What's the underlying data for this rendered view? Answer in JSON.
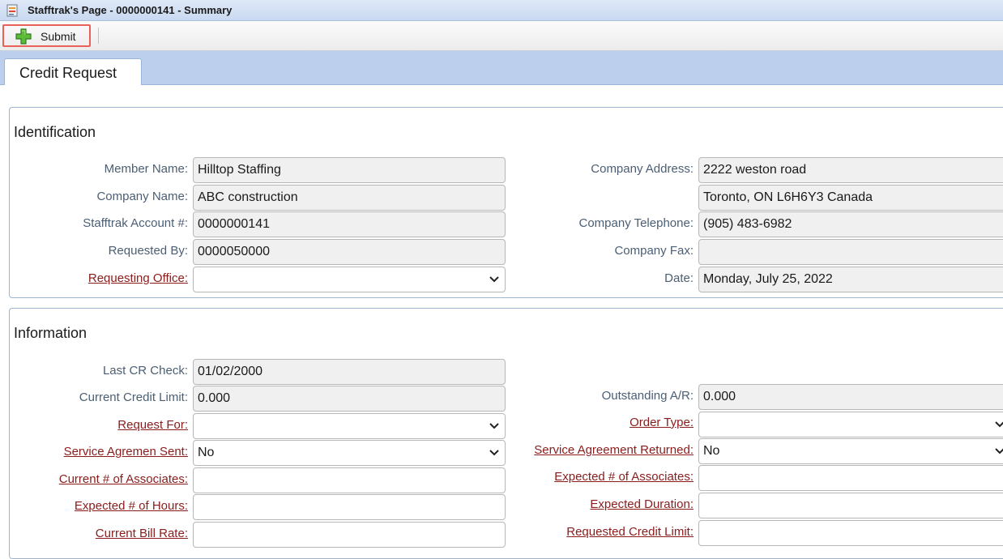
{
  "window": {
    "title": "Stafftrak's Page - 0000000141 - Summary",
    "icon": "window-app-icon"
  },
  "toolbar": {
    "submit_label": "Submit",
    "submit_icon": "plus-icon"
  },
  "tabs": [
    {
      "label": "Credit Request",
      "active": true
    }
  ],
  "identification": {
    "legend": "Identification",
    "member_name": {
      "label": "Member Name:",
      "value": "Hilltop Staffing"
    },
    "company_name": {
      "label": "Company Name:",
      "value": "ABC construction"
    },
    "account": {
      "label": "Stafftrak Account #:",
      "value": "0000000141"
    },
    "requested_by": {
      "label": "Requested By:",
      "value": "0000050000"
    },
    "requesting_office": {
      "label": "Requesting Office:",
      "value": ""
    },
    "company_address": {
      "label": "Company Address:",
      "line1": "2222 weston road",
      "line2": "Toronto, ON L6H6Y3 Canada"
    },
    "company_telephone": {
      "label": "Company Telephone:",
      "value": "(905) 483-6982"
    },
    "company_fax": {
      "label": "Company Fax:",
      "value": ""
    },
    "date": {
      "label": "Date:",
      "value": "Monday, July 25, 2022"
    }
  },
  "information": {
    "legend": "Information",
    "last_cr_check": {
      "label": "Last CR Check:",
      "value": "01/02/2000"
    },
    "current_credit_limit": {
      "label": "Current Credit Limit:",
      "value": "0.000"
    },
    "request_for": {
      "label": "Request For:",
      "value": ""
    },
    "service_agreement_sent": {
      "label": "Service Agremen Sent:",
      "value": "No"
    },
    "current_associates": {
      "label": "Current # of Associates:",
      "value": ""
    },
    "expected_hours": {
      "label": "Expected # of Hours:",
      "value": ""
    },
    "current_bill_rate": {
      "label": "Current Bill Rate:",
      "value": ""
    },
    "outstanding_ar": {
      "label": "Outstanding A/R:",
      "value": "0.000"
    },
    "order_type": {
      "label": "Order Type:",
      "value": ""
    },
    "service_agreement_returned": {
      "label": "Service Agreement Returned:",
      "value": "No"
    },
    "expected_associates": {
      "label": "Expected # of Associates:",
      "value": ""
    },
    "expected_duration": {
      "label": "Expected Duration:",
      "value": ""
    },
    "requested_credit_limit": {
      "label": "Requested Credit Limit:",
      "value": ""
    }
  },
  "colors": {
    "link_label": "#8a1c1c",
    "label": "#4b5e73",
    "tabstrip": "#bcd0ee",
    "highlight": "#e8625a"
  }
}
